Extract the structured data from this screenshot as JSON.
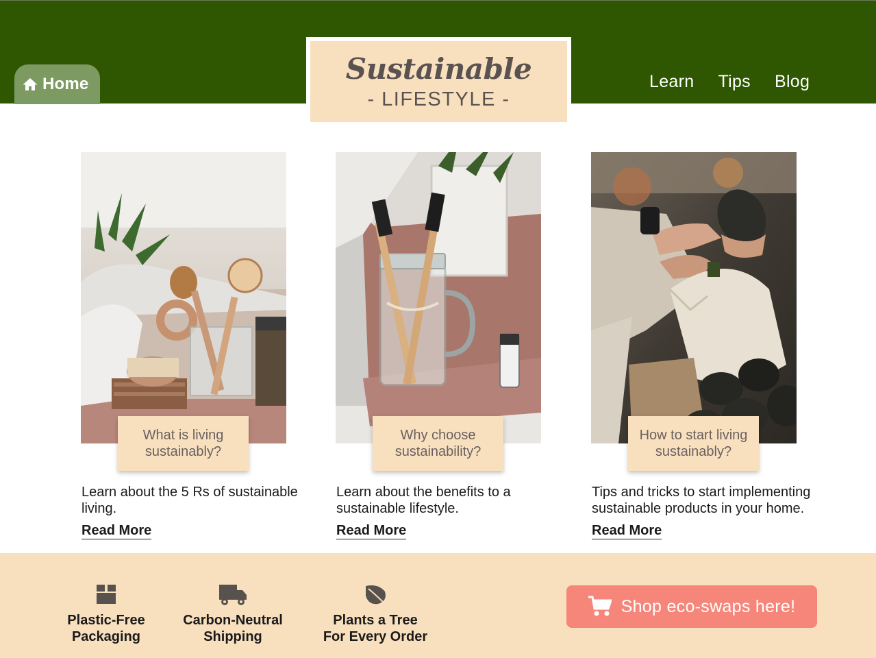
{
  "header": {
    "home_label": "Home",
    "logo_script": "Sustainable",
    "logo_sub": "- LIFESTYLE -",
    "nav": [
      "Learn",
      "Tips",
      "Blog"
    ]
  },
  "cards": [
    {
      "caption": "What is living sustainably?",
      "description": "Learn about the 5 Rs of sustainable living.",
      "link": "Read More"
    },
    {
      "caption": "Why choose sustainability?",
      "description": "Learn about the benefits to a sustainable lifestyle.",
      "link": "Read More"
    },
    {
      "caption": "How to start living sustainably?",
      "description": "Tips and tricks to start implementing sustainable products in your home.",
      "link": "Read More"
    }
  ],
  "footer": {
    "features": [
      {
        "icon": "box-icon",
        "line1": "Plastic-Free",
        "line2": "Packaging"
      },
      {
        "icon": "truck-icon",
        "line1": "Carbon-Neutral",
        "line2": "Shipping"
      },
      {
        "icon": "leaf-icon",
        "line1": "Plants a Tree",
        "line2": "For Every Order"
      }
    ],
    "shop_button": "Shop eco-swaps here!"
  },
  "colors": {
    "header_green": "#2f5600",
    "home_tab": "#7d9a63",
    "cream": "#f8e0bf",
    "shop_button": "#f6867a"
  }
}
